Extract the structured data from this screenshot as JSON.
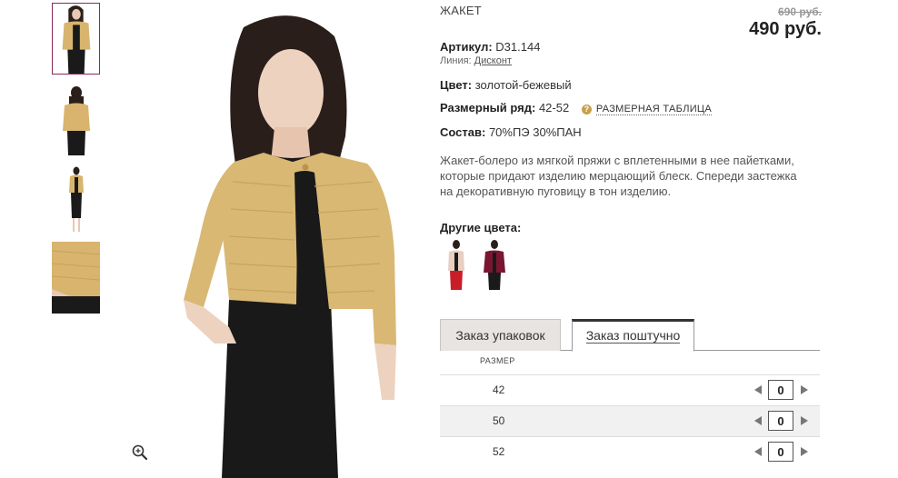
{
  "product": {
    "title": "ЖАКЕТ",
    "old_price": "690 руб.",
    "new_price": "490 руб.",
    "article_label": "Артикул:",
    "article_value": "D31.144",
    "line_label": "Линия:",
    "line_value": "Дисконт",
    "color_label": "Цвет:",
    "color_value": "золотой-бежевый",
    "size_range_label": "Размерный ряд:",
    "size_range_value": "42-52",
    "size_table_link": "РАЗМЕРНАЯ ТАБЛИЦА",
    "size_help_icon": "?",
    "composition_label": "Состав:",
    "composition_value": "70%ПЭ 30%ПАН",
    "description": "Жакет-болеро из мягкой пряжи с вплетенными в нее пайетками, которые придают изделию мерцающий блеск. Спереди застежка на декоративную пуговицу в тон изделию.",
    "other_colors_title": "Другие цвета:"
  },
  "colors": {
    "accent": "#8a2a5a",
    "jacket_gold": "#d9b874",
    "dress_black": "#1a1a1a",
    "swatch_beige": "#e8cfc2",
    "swatch_burgundy": "#7a1630"
  },
  "tabs": [
    {
      "label": "Заказ упаковок",
      "active": false
    },
    {
      "label": "Заказ поштучно",
      "active": true
    }
  ],
  "size_table": {
    "header": "РАЗМЕР",
    "rows": [
      {
        "size": "42",
        "qty": "0"
      },
      {
        "size": "50",
        "qty": "0"
      },
      {
        "size": "52",
        "qty": "0"
      }
    ]
  },
  "icons": {
    "zoom": "zoom-in-icon",
    "prev": "arrow-left-icon",
    "next": "arrow-right-icon"
  }
}
